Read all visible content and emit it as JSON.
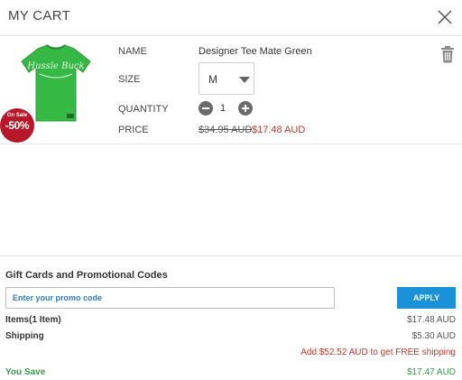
{
  "header": {
    "title": "MY CART"
  },
  "item": {
    "badge_top": "On Sale",
    "badge_pct": "-50%",
    "name_label": "NAME",
    "name": "Designer Tee Mate Green",
    "size_label": "SIZE",
    "size": "M",
    "quantity_label": "QUANTITY",
    "quantity": "1",
    "price_label": "PRICE",
    "old_price": "$34.95 AUD",
    "new_price": "$17.48 AUD",
    "shirt_color": "#35b844",
    "shirt_text": "Hussle Buck"
  },
  "promo": {
    "title": "Gift Cards and Promotional Codes",
    "placeholder": "Enter your promo code",
    "apply_label": "APPLY"
  },
  "summary": {
    "items_label": "Items(1 Item)",
    "items_value": "$17.48 AUD",
    "shipping_label": "Shipping",
    "shipping_value": "$5.30 AUD",
    "free_shipping_note": "Add $52.52 AUD to get FREE shipping",
    "save_label": "You Save",
    "save_value": "$17.47 AUD"
  },
  "colors": {
    "accent": "#1a91d9",
    "sale_red": "#b8172a",
    "price_red": "#c0392b",
    "save_green": "#3a9b4b"
  }
}
